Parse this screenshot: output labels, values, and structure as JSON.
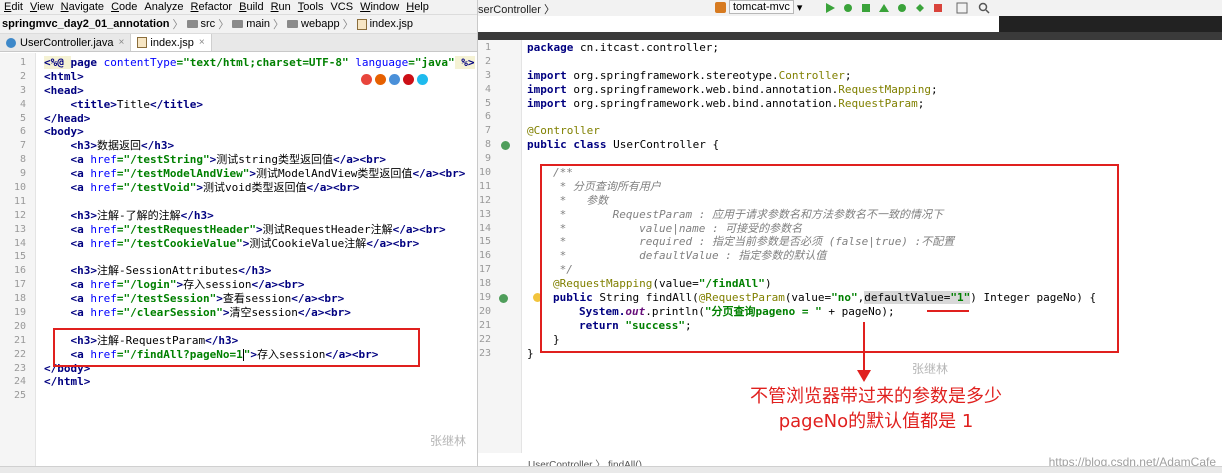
{
  "left": {
    "menu": [
      {
        "mn": "E",
        "rest": "dit"
      },
      {
        "mn": "V",
        "rest": "iew"
      },
      {
        "mn": "N",
        "rest": "avigate"
      },
      {
        "mn": "C",
        "rest": "ode"
      },
      {
        "mn": "",
        "rest": "Analyze"
      },
      {
        "mn": "R",
        "rest": "efactor"
      },
      {
        "mn": "B",
        "rest": "uild"
      },
      {
        "mn": "R",
        "rest": "un"
      },
      {
        "mn": "T",
        "rest": "ools"
      },
      {
        "mn": "",
        "rest": "VCS"
      },
      {
        "mn": "W",
        "rest": "indow"
      },
      {
        "mn": "H",
        "rest": "elp"
      }
    ],
    "breadcrumb": {
      "project": "springmvc_day2_01_annotation",
      "p1": "src",
      "p2": "main",
      "p3": "webapp",
      "file": "index.jsp"
    },
    "tabs": {
      "tab1": "UserController.java",
      "tab2": "index.jsp",
      "close": "×"
    },
    "line_numbers": [
      "1",
      "2",
      "3",
      "4",
      "5",
      "6",
      "7",
      "8",
      "9",
      "10",
      "11",
      "12",
      "13",
      "14",
      "15",
      "16",
      "17",
      "18",
      "19",
      "20",
      "21",
      "22",
      "23",
      "24",
      "25"
    ],
    "code": {
      "l1_open": "<%@ ",
      "l1_page": "page ",
      "l1_a1": "contentType",
      "l1_v1": "=\"text/html;charset=UTF-8\"",
      "l1_a2": " language",
      "l1_v2": "=\"java\"",
      "l1_end": " %>",
      "html_open": "<html>",
      "head_open": "<head>",
      "title_open": "<title>",
      "title_text": "Title",
      "title_close": "</title>",
      "head_close": "</head>",
      "body_open": "<body>",
      "h3_open": "<h3>",
      "h3_close": "</h3>",
      "a_open": "<a ",
      "href": "href",
      "a_close": "</a>",
      "br": "<br>",
      "gt": ">",
      "l7_text": "数据返回",
      "l8_href": "=\"/testString\"",
      "l8_text": "测试string类型返回值",
      "l9_href": "=\"/testModelAndView\"",
      "l9_text": "测试ModelAndView类型返回值",
      "l10_href": "=\"/testVoid\"",
      "l10_text": "测试void类型返回值",
      "l12_text": "注解-了解的注解",
      "l13_href": "=\"/testRequestHeader\"",
      "l13_text": "测试RequestHeader注解",
      "l14_href": "=\"/testCookieValue\"",
      "l14_text": "测试CookieValue注解",
      "l16_text": "注解-SessionAttributes",
      "l17_href": "=\"/login\"",
      "l17_text": "存入session",
      "l18_href": "=\"/testSession\"",
      "l18_text": "查看session",
      "l19_href": "=\"/clearSession\"",
      "l19_text": "清空session",
      "l21_text": "注解-RequestParam",
      "l22_href_a": "=\"/findAll?pageNo=1",
      "l22_href_b": "\"",
      "l22_text": "存入session",
      "body_close": "</body>",
      "html_close": "</html>"
    },
    "watermark": "张继林"
  },
  "right": {
    "top_breadcrumb": "serController 〉",
    "run_config": "tomcat-mvc",
    "dropdown_arrow": "▾",
    "line_numbers": [
      "1",
      "2",
      "3",
      "4",
      "5",
      "6",
      "7",
      "8",
      "9",
      "10",
      "11",
      "12",
      "13",
      "14",
      "15",
      "16",
      "17",
      "18",
      "19",
      "20",
      "21",
      "22",
      "23"
    ],
    "code": {
      "package_kw": "package",
      "package_name": " cn.itcast.controller;",
      "import_kw": "import",
      "imp1": " org.springframework.stereotype.",
      "imp1_cls": "Controller",
      "imp2": " org.springframework.web.bind.annotation.",
      "imp2_cls": "RequestMapping",
      "imp3": " org.springframework.web.bind.annotation.",
      "imp3_cls": "RequestParam",
      "semi": ";",
      "ann_controller": "@Controller",
      "class_kw": "public class",
      "class_name": " UserController {",
      "c10": "/**",
      "c11": " * 分页查询所有用户",
      "c12": " *   参数",
      "c13": " *       RequestParam : 应用于请求参数名和方法参数名不一致的情况下",
      "c14": " *           value|name : 可接受的参数名",
      "c15": " *           required : 指定当前参数是否必须 (false|true) :不配置",
      "c16": " *           defaultValue : 指定参数的默认值",
      "c17": " */",
      "l18_ann": "@RequestMapping",
      "l18_a": "(value=",
      "l18_str": "\"/findAll\"",
      "l18_b": ")",
      "l19_kw": "public",
      "l19_a": " String findAll(",
      "l19_ann": "@RequestParam",
      "l19_b": "(value=",
      "l19_str1": "\"no\"",
      "l19_c": ",",
      "l19_d": "defaultValue=",
      "l19_str2": "\"1\"",
      "l19_e": ") Integer pageNo) {",
      "l20_a": "System.",
      "l20_out": "out",
      "l20_b": ".println(",
      "l20_str": "\"分页查询pageno = \"",
      "l20_c": " + ",
      "l20_d": "pageNo",
      "l20_e": ");",
      "l21_kw": "return",
      "l21_str": " \"success\"",
      "l21_e": ";",
      "close_inner": "}",
      "close_outer": "}"
    },
    "annotation_line1": "不管浏览器带过来的参数是多少",
    "annotation_line2": "pageNo的默认值都是 1",
    "watermark": "张继林",
    "status_crumb": "UserController 〉 findAll()",
    "csdn": "https://blog.csdn.net/AdamCafe"
  },
  "colors": {
    "highlight": "#e0201e",
    "keyword": "#000080",
    "string": "#008000",
    "annotation": "#808000",
    "comment": "#808080"
  },
  "icons": [
    "folder-icon",
    "jsp-icon",
    "class-icon",
    "chrome-icon",
    "firefox-icon",
    "safari-icon",
    "opera-icon",
    "ie-icon",
    "run-icon",
    "debug-icon",
    "tomcat-icon"
  ]
}
